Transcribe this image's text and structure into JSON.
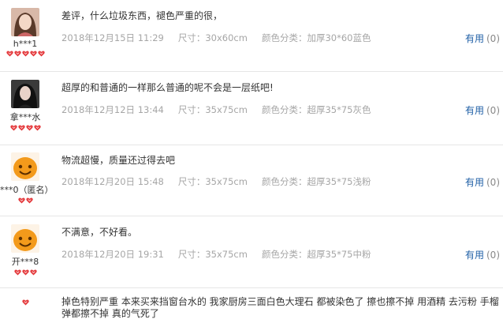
{
  "reviews": [
    {
      "username": "h***1",
      "avatar": "photo-girl-1",
      "hearts": 5,
      "content": "差评，什么垃圾东西，褪色严重的很，",
      "date": "2018年12月15日 11:29",
      "size": "尺寸：30x60cm",
      "color": "颜色分类：加厚30*60蓝色",
      "useful_label": "有用",
      "useful_count": "(0)"
    },
    {
      "username": "拿***水",
      "avatar": "photo-girl-2",
      "hearts": 4,
      "content": "超厚的和普通的一样那么普通的呢不会是一层纸吧!",
      "date": "2018年12月12日 13:44",
      "size": "尺寸：35x75cm",
      "color": "颜色分类：超厚35*75灰色",
      "useful_label": "有用",
      "useful_count": "(0)"
    },
    {
      "username": "***0（匿名）",
      "avatar": "default-orange",
      "hearts": 2,
      "content": "物流超慢，质量还过得去吧",
      "date": "2018年12月20日 15:48",
      "size": "尺寸：35x75cm",
      "color": "颜色分类：超厚35*75浅粉",
      "useful_label": "有用",
      "useful_count": "(0)"
    },
    {
      "username": "开***8",
      "avatar": "default-orange",
      "hearts": 3,
      "content": "不满意，不好看。",
      "date": "2018年12月20日 19:31",
      "size": "尺寸：35x75cm",
      "color": "颜色分类：超厚35*75中粉",
      "useful_label": "有用",
      "useful_count": "(0)"
    },
    {
      "username": "",
      "avatar": "",
      "hearts": 1,
      "content": "掉色特别严重 本来买来挡窗台水的 我家厨房三面白色大理石 都被染色了 擦也擦不掉 用酒精 去污粉 手榴弹都擦不掉 真的气死了",
      "date": "",
      "size": "",
      "color": "",
      "useful_label": "",
      "useful_count": ""
    }
  ],
  "colors": {
    "link": "#1f5fa6",
    "meta": "#a6a6a6",
    "heart": "#e4393c",
    "avatar_orange": "#f39a1b"
  }
}
